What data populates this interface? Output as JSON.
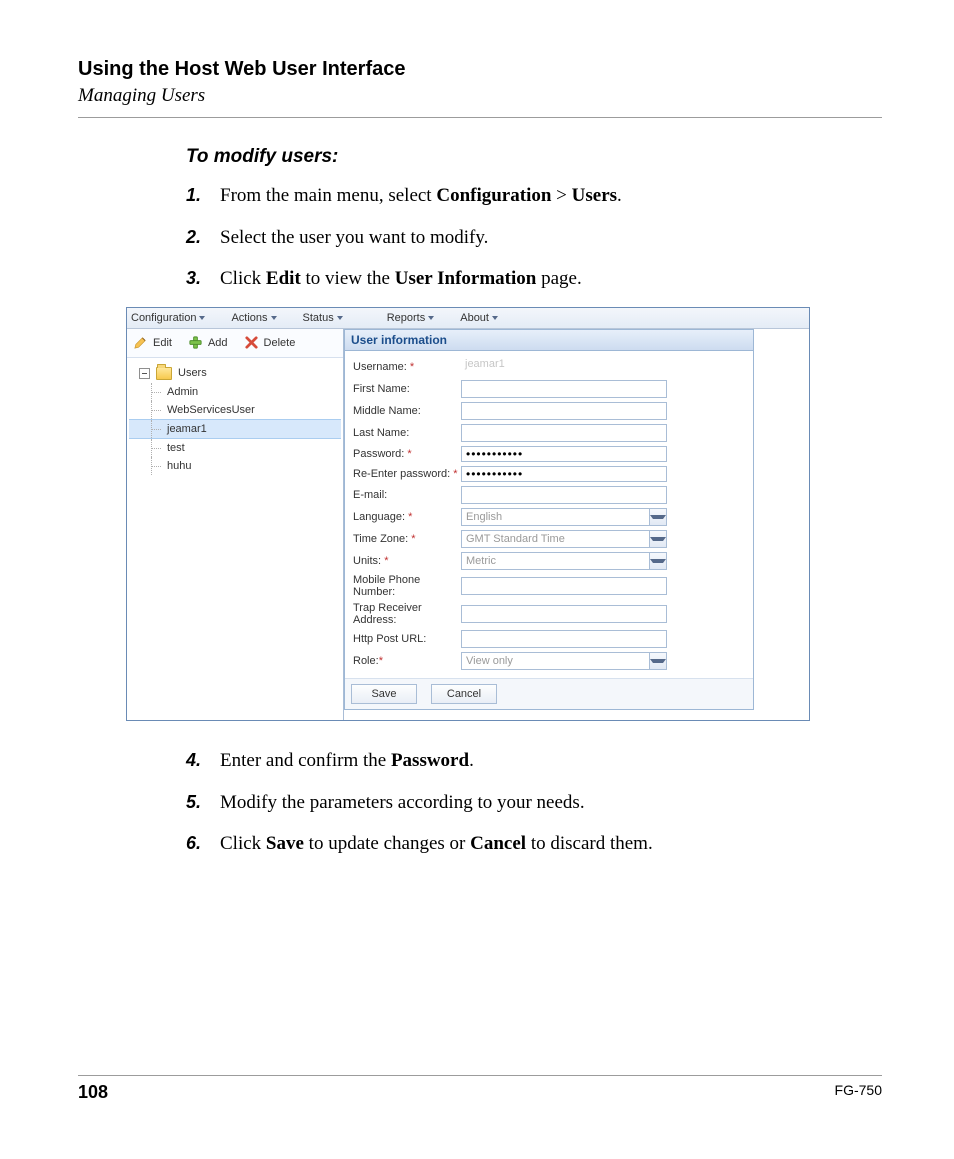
{
  "header": {
    "chapter": "Using the Host Web User Interface",
    "section": "Managing Users"
  },
  "procedure": {
    "title": "To modify users:",
    "steps_a": [
      {
        "pre": "From the main menu, select ",
        "b1": "Configuration",
        "mid": " > ",
        "b2": "Users",
        "post": "."
      },
      {
        "pre": "Select the user you want to modify.",
        "b1": "",
        "mid": "",
        "b2": "",
        "post": ""
      },
      {
        "pre": "Click ",
        "b1": "Edit",
        "mid": " to view the ",
        "b2": "User Information",
        "post": " page."
      }
    ],
    "steps_b": [
      {
        "pre": "Enter and confirm the ",
        "b1": "Password",
        "mid": "",
        "b2": "",
        "post": "."
      },
      {
        "pre": "Modify the parameters according to your needs.",
        "b1": "",
        "mid": "",
        "b2": "",
        "post": ""
      },
      {
        "pre": "Click ",
        "b1": "Save",
        "mid": " to update changes or ",
        "b2": "Cancel",
        "post": " to discard them."
      }
    ]
  },
  "screenshot": {
    "menus": [
      "Configuration",
      "Actions",
      "Status",
      "Reports",
      "About"
    ],
    "toolbar": {
      "edit": "Edit",
      "add": "Add",
      "delete": "Delete"
    },
    "tree": {
      "root": "Users",
      "items": [
        "Admin",
        "WebServicesUser",
        "jeamar1",
        "test",
        "huhu"
      ],
      "selected_index": 2
    },
    "panel_title": "User information",
    "form": {
      "username_label": "Username:",
      "username_value": "jeamar1",
      "first_name_label": "First Name:",
      "middle_name_label": "Middle Name:",
      "last_name_label": "Last Name:",
      "password_label": "Password:",
      "password_dots": "•••••••••••",
      "reenter_label": "Re-Enter password:",
      "email_label": "E-mail:",
      "language_label": "Language:",
      "language_value": "English",
      "timezone_label": "Time Zone:",
      "timezone_value": "GMT Standard Time",
      "units_label": "Units:",
      "units_value": "Metric",
      "mobile_label": "Mobile Phone Number:",
      "trap_label": "Trap Receiver Address:",
      "http_label": "Http Post URL:",
      "role_label": "Role:",
      "role_value": "View only"
    },
    "buttons": {
      "save": "Save",
      "cancel": "Cancel"
    }
  },
  "footer": {
    "page_num": "108",
    "doc_id": "FG-750"
  }
}
